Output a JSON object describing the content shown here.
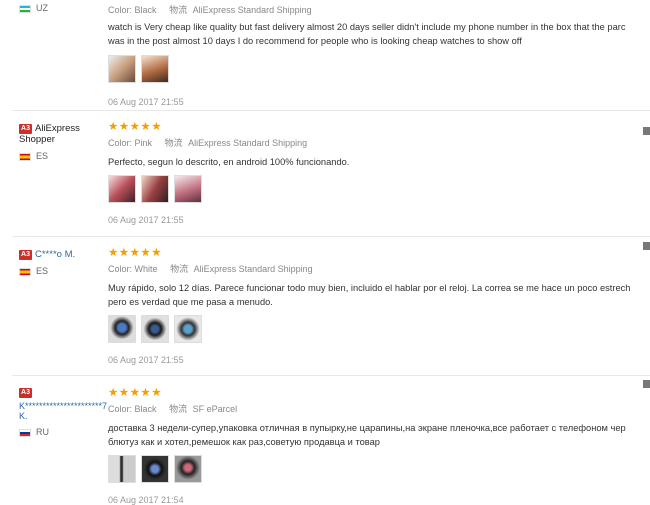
{
  "reviews": [
    {
      "badge": "",
      "user": "",
      "country": "UZ",
      "flag": "uz",
      "stars": "",
      "color_label": "Color:",
      "color_value": "Black",
      "shipping_label": "物流",
      "shipping_value": "AliExpress Standard Shipping",
      "text_lines": [
        "watch is Very cheap like quality but fast delivery almost 20 days seller didn't include my phone number in the box that the parc",
        "was in the post almost 10 days I do recommend for people who is looking cheap watches to show off"
      ],
      "thumbs": 2,
      "date": "06 Aug 2017 21:55"
    },
    {
      "badge": "A3",
      "user": "AliExpress Shopper",
      "country": "ES",
      "flag": "es",
      "stars": "★★★★★",
      "color_label": "Color:",
      "color_value": "Pink",
      "shipping_label": "物流",
      "shipping_value": "AliExpress Standard Shipping",
      "text_lines": [
        "Perfecto, segun lo descrito, en android 100% funcionando."
      ],
      "thumbs": 3,
      "date": "06 Aug 2017 21:55"
    },
    {
      "badge": "A3",
      "user": "C****o M.",
      "country": "ES",
      "flag": "es",
      "stars": "★★★★★",
      "color_label": "Color:",
      "color_value": "White",
      "shipping_label": "物流",
      "shipping_value": "AliExpress Standard Shipping",
      "text_lines": [
        "Muy rápido, solo 12 días. Parece funcionar todo muy bien, incluido el hablar por el reloj. La correa se me hace un poco estrech",
        "pero es verdad que me pasa a menudo."
      ],
      "thumbs": 3,
      "date": "06 Aug 2017 21:55"
    },
    {
      "badge": "A3",
      "user": "K**********************7",
      "user_line2": "K.",
      "country": "RU",
      "flag": "ru",
      "stars": "★★★★★",
      "color_label": "Color:",
      "color_value": "Black",
      "shipping_label": "物流",
      "shipping_value": "SF eParcel",
      "text_lines": [
        "доставка 3 недели-супер,упаковка отличная в пупырку,не царапины,на экране пленочка,все работает с телефоном чер",
        "блютуз как и хотел,ремешок как раз,советую продавца и товар"
      ],
      "thumbs": 3,
      "date": "06 Aug 2017 21:54"
    }
  ],
  "colors": {
    "star": "#f49d05",
    "badge": "#c9302c",
    "link": "#2a65b3"
  }
}
